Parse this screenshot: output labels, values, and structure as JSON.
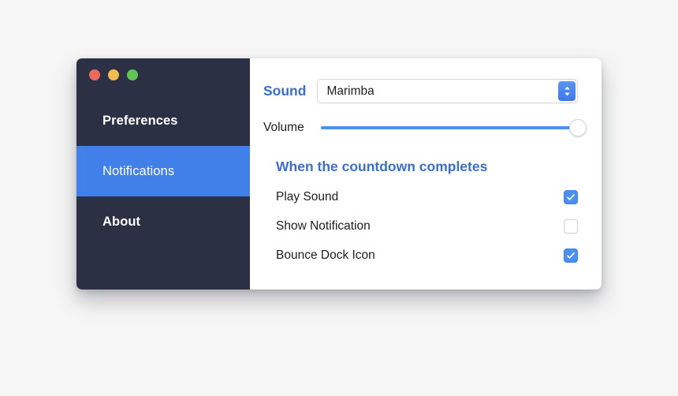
{
  "window": {
    "traffic_lights": [
      {
        "name": "close",
        "color": "#ec6a5f"
      },
      {
        "name": "minimize",
        "color": "#f4bd4f"
      },
      {
        "name": "maximize",
        "color": "#61c554"
      }
    ]
  },
  "sidebar": {
    "background": "#2b3044",
    "selected_color": "#4180e8",
    "items": [
      {
        "label": "Preferences",
        "selected": false
      },
      {
        "label": "Notifications",
        "selected": true
      },
      {
        "label": "About",
        "selected": false
      }
    ]
  },
  "content": {
    "accent_color": "#3b6fc8",
    "sound": {
      "label": "Sound",
      "selected_option": "Marimba",
      "stepper_icon": "chevron-up-down-icon"
    },
    "volume": {
      "label": "Volume",
      "value": 100,
      "fill_color": "#4a90f0"
    },
    "completion": {
      "heading": "When the countdown completes",
      "options": [
        {
          "label": "Play Sound",
          "checked": true
        },
        {
          "label": "Show Notification",
          "checked": false
        },
        {
          "label": "Bounce Dock Icon",
          "checked": true
        }
      ]
    }
  }
}
